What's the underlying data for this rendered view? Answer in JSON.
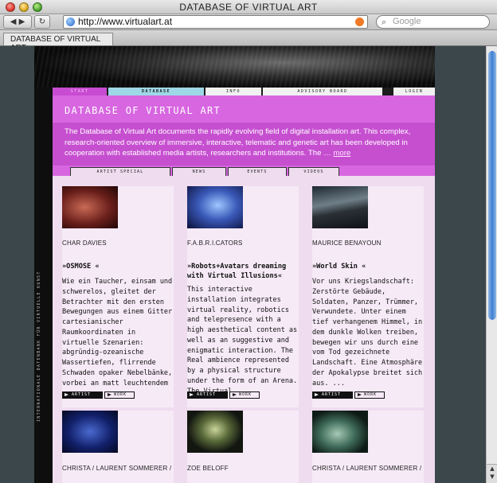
{
  "window": {
    "title": "DATABASE OF VIRTUAL ART"
  },
  "toolbar": {
    "back_icon": "back-arrow-icon",
    "forward_icon": "forward-arrow-icon",
    "reload_icon": "reload-icon",
    "url": "http://www.virtualart.at",
    "search_placeholder": "Google"
  },
  "tab": {
    "label": "DATABASE OF VIRTUAL ART"
  },
  "site": {
    "vertical_text": "INTERNATIONALE DATENBANK FÜR VIRTUELLE KUNST",
    "nav": [
      "START",
      "DATABASE",
      "INFO",
      "ADVISORY BOARD",
      "LOGIN"
    ],
    "heading": "DATABASE OF VIRTUAL ART",
    "intro": "The Database of Virtual Art documents the rapidly evolving field of digital installation art. This complex, research-oriented overview of immersive, interactive, telematic and genetic art has been developed in cooperation with established media artists, researchers and institutions. The … ",
    "intro_more": "more",
    "subnav": [
      "ARTIST SPECIAL",
      "NEWS",
      "EVENTS",
      "VIDEOS"
    ],
    "cards": [
      {
        "artist": "CHAR DAVIES",
        "title": "»OSMOSE «",
        "desc": "Wie ein Taucher, einsam und schwerelos, gleitet der Betrachter mit den ersten Bewegungen aus einem Gitter cartesianischer Raumkoordinaten in virtuelle Szenarien: abgründig-ozeanische Wassertiefen, flirrende Schwaden opaker Nebelbänke, vorbei an matt leuchtendem ...",
        "btn_artist": "ARTIST",
        "btn_work": "WORK"
      },
      {
        "artist": "F.A.B.R.I.CATORS",
        "title": "»Robots+Avatars dreaming with Virtual Illusions«",
        "desc": "This interactive installation integrates virtual reality, robotics and telepresence with a high aesthetical content as well as an suggestive and enigmatic interaction. The Real ambience represented by a physical structure under the form of an Arena. The Virtual ...",
        "btn_artist": "ARTIST",
        "btn_work": "WORK"
      },
      {
        "artist": "MAURICE BENAYOUN",
        "title": "»World Skin «",
        "desc": "Vor uns Kriegslandschaft: Zerstörte Gebäude, Soldaten, Panzer, Trümmer, Verwundete. Unter einem tief verhangenem Himmel, in dem dunkle Wolken treiben, bewegen wir uns durch eine vom Tod gezeichnete Landschaft. Eine Atmosphäre der Apokalypse breitet sich aus. ...",
        "btn_artist": "ARTIST",
        "btn_work": "WORK"
      },
      {
        "artist": "CHRISTA / LAURENT SOMMERER /"
      },
      {
        "artist": "ZOE BELOFF"
      },
      {
        "artist": "CHRISTA / LAURENT SOMMERER /"
      }
    ]
  },
  "colors": {
    "accent_magenta": "#c64fd0",
    "accent_cyan": "#9ed8e6",
    "page_bg": "#efdcef"
  }
}
